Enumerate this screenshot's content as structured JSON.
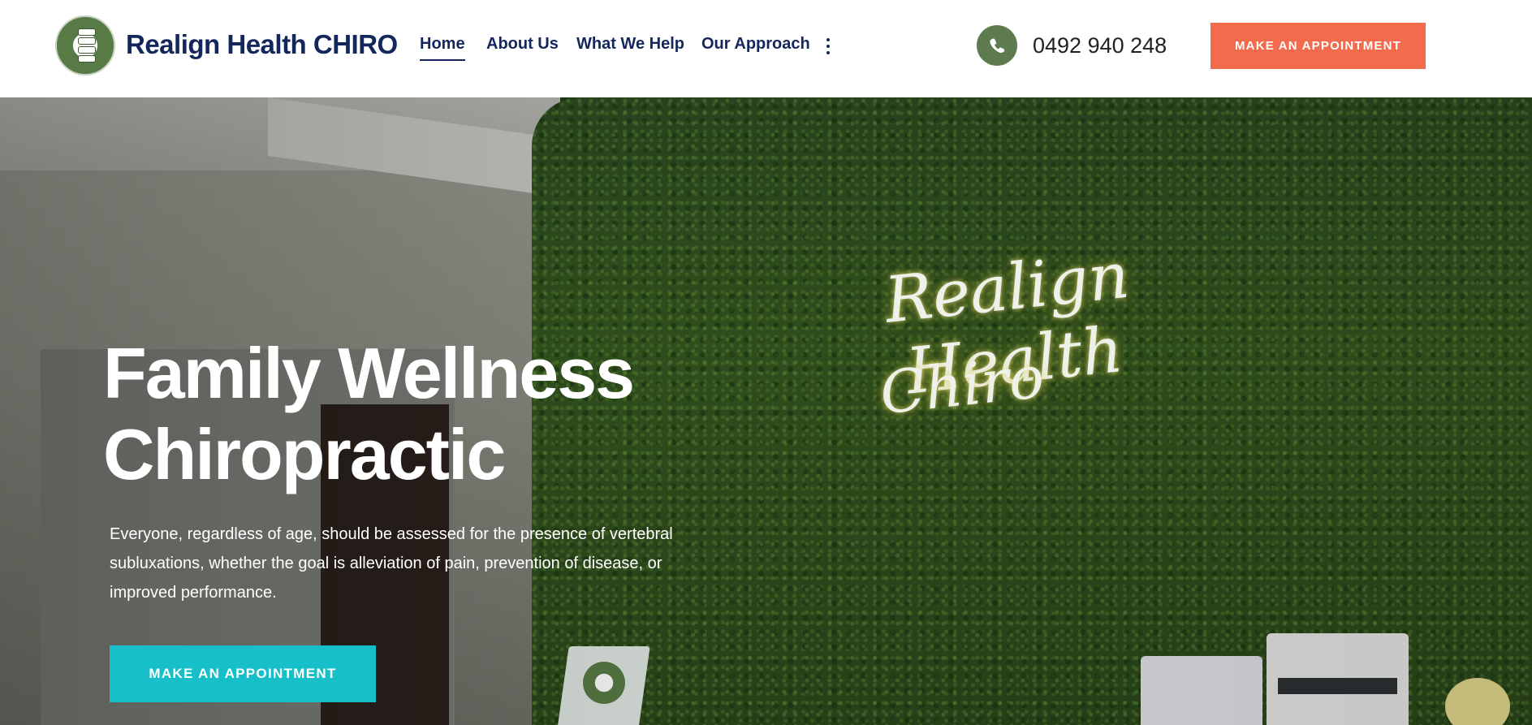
{
  "header": {
    "brand": "Realign Health CHIRO",
    "nav": [
      {
        "label": "Home",
        "active": true
      },
      {
        "label": "About Us",
        "active": false
      },
      {
        "label": "What We Help",
        "active": false
      },
      {
        "label": "Our Approach",
        "active": false
      }
    ],
    "more_icon": "kebab-menu-icon",
    "phone_icon": "phone-icon",
    "phone": "0492 940 248",
    "cta": "MAKE AN APPOINTMENT"
  },
  "hero": {
    "title": "Family Wellness Chiropractic",
    "description": "Everyone, regardless of age, should be assessed for the presence of vertebral subluxations, whether the goal is alleviation of pain, prevention of disease, or improved performance.",
    "cta": "MAKE AN APPOINTMENT",
    "neon_sign_line1": "Realign Health",
    "neon_sign_line2": "Chiro"
  },
  "colors": {
    "brand_navy": "#14275c",
    "accent_orange": "#f26b4d",
    "accent_teal": "#17bfc9",
    "phone_green": "#5e7a4f"
  }
}
